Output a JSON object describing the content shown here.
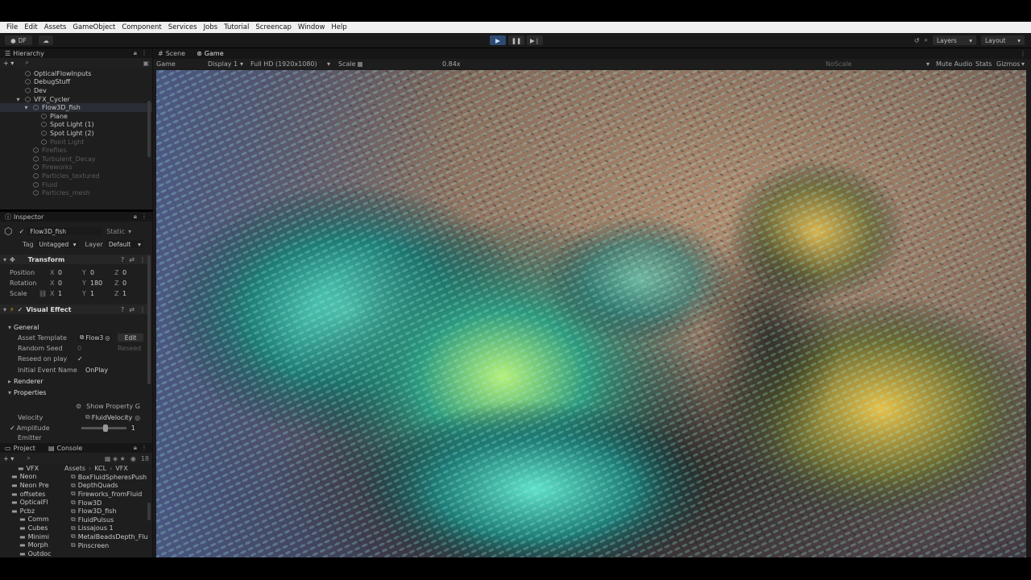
{
  "menubar": [
    "File",
    "Edit",
    "Assets",
    "GameObject",
    "Component",
    "Services",
    "Jobs",
    "Tutorial",
    "Screencap",
    "Window",
    "Help"
  ],
  "toolbar": {
    "account": "DF",
    "play_icon": "play-icon",
    "pause_icon": "pause-icon",
    "step_icon": "step-icon",
    "layers": "Layers",
    "layout": "Layout"
  },
  "hierarchy": {
    "tab": "Hierarchy",
    "items": [
      {
        "label": "OpticalFlowInputs",
        "indent": 1,
        "dim": false,
        "selected": false,
        "icon": "gameobject-icon"
      },
      {
        "label": "DebugStuff",
        "indent": 1,
        "dim": false,
        "selected": false,
        "icon": "gameobject-icon"
      },
      {
        "label": "Dev",
        "indent": 1,
        "dim": false,
        "selected": false,
        "icon": "gameobject-icon"
      },
      {
        "label": "VFX_Cycler",
        "indent": 1,
        "dim": false,
        "selected": false,
        "icon": "gameobject-icon"
      },
      {
        "label": "Flow3D_fish",
        "indent": 2,
        "dim": false,
        "selected": true,
        "icon": "gameobject-icon"
      },
      {
        "label": "Plane",
        "indent": 3,
        "dim": false,
        "selected": false,
        "icon": "gameobject-icon"
      },
      {
        "label": "Spot Light (1)",
        "indent": 3,
        "dim": false,
        "selected": false,
        "icon": "gameobject-icon"
      },
      {
        "label": "Spot Light (2)",
        "indent": 3,
        "dim": false,
        "selected": false,
        "icon": "gameobject-icon"
      },
      {
        "label": "Point Light",
        "indent": 3,
        "dim": true,
        "selected": false,
        "icon": "gameobject-icon"
      },
      {
        "label": "Fireflies",
        "indent": 2,
        "dim": true,
        "selected": false,
        "icon": "gameobject-icon"
      },
      {
        "label": "Turbulent_Decay",
        "indent": 2,
        "dim": true,
        "selected": false,
        "icon": "gameobject-icon"
      },
      {
        "label": "Fireworks",
        "indent": 2,
        "dim": true,
        "selected": false,
        "icon": "gameobject-icon"
      },
      {
        "label": "Particles_textured",
        "indent": 2,
        "dim": true,
        "selected": false,
        "icon": "gameobject-icon"
      },
      {
        "label": "Fluid",
        "indent": 2,
        "dim": true,
        "selected": false,
        "icon": "gameobject-icon"
      },
      {
        "label": "Particles_mesh",
        "indent": 2,
        "dim": true,
        "selected": false,
        "icon": "gameobject-icon"
      }
    ]
  },
  "inspector": {
    "tab": "Inspector",
    "object_name": "Flow3D_fish",
    "static_label": "Static",
    "tag_label": "Tag",
    "tag_value": "Untagged",
    "layer_label": "Layer",
    "layer_value": "Default",
    "transform": {
      "title": "Transform",
      "rows": [
        {
          "label": "Position",
          "x": "0",
          "y": "0",
          "z": "0"
        },
        {
          "label": "Rotation",
          "x": "0",
          "y": "180",
          "z": "0"
        },
        {
          "label": "Scale",
          "x": "1",
          "y": "1",
          "z": "1"
        }
      ]
    },
    "visual_effect": {
      "title": "Visual Effect",
      "general": "General",
      "asset_template_label": "Asset Template",
      "asset_template_value": "Flow3",
      "edit_button": "Edit",
      "random_seed_label": "Random Seed",
      "random_seed_value": "0",
      "reseed_button": "Reseed",
      "reseed_on_play_label": "Reseed on play",
      "initial_event_label": "Initial Event Name",
      "initial_event_value": "OnPlay",
      "renderer": "Renderer",
      "properties": "Properties",
      "show_property": "Show Property G",
      "velocity_label": "Velocity",
      "velocity_value": "FluidVelocity",
      "amplitude_label": "Amplitude",
      "amplitude_value": "1",
      "amplitude_level": 0.55,
      "cropped_label": "Emitter"
    }
  },
  "project": {
    "tab_project": "Project",
    "tab_console": "Console",
    "count": "18",
    "breadcrumb": [
      "Assets",
      "KCL",
      "VFX"
    ],
    "folders": [
      "VFX",
      "Neon",
      "Neon Pre",
      "offsetes",
      "OpticalFl",
      "Pcbz",
      "Comm",
      "Cubes",
      "Minimi",
      "Morph",
      "Outdoc"
    ],
    "assets": [
      "BoxFluidSpheresPush",
      "DepthQuads",
      "Fireworks_fromFluid",
      "Flow3D",
      "Flow3D_fish",
      "FluidPulsus",
      "Lissajous 1",
      "MetalBeadsDepth_Flu",
      "Pinscreen"
    ]
  },
  "gameview": {
    "tab_scene": "Scene",
    "tab_game": "Game",
    "mode": "Game",
    "display": "Display 1",
    "resolution": "Full HD (1920x1080)",
    "scale_label": "Scale",
    "scale_value": "0.84x",
    "noscale": "NoScale",
    "mute_audio": "Mute Audio",
    "stats": "Stats",
    "gizmos": "Gizmos"
  },
  "colors": {
    "editor_bg": "#1e1e1e",
    "menubar_bg": "#f0f0f0",
    "play_active": "#2c4a72",
    "fish_teal": "#2fa39a",
    "fish_gold": "#c9a13a",
    "sand": "#9a7a62"
  }
}
